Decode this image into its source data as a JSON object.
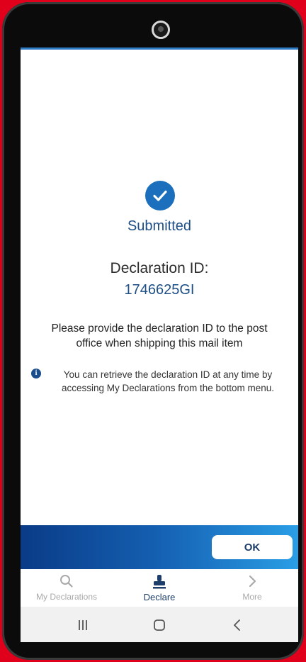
{
  "confirmation": {
    "status": "Submitted",
    "declaration_label": "Declaration ID:",
    "declaration_id": "1746625GI",
    "instruction": "Please provide the declaration ID to the post office when shipping this mail item",
    "info_icon": "info-icon",
    "info_text": "You can retrieve the declaration ID at any time by accessing My Declarations from the bottom menu."
  },
  "actions": {
    "ok_label": "OK"
  },
  "tabs": [
    {
      "label": "My Declarations",
      "icon": "search-icon",
      "active": false
    },
    {
      "label": "Declare",
      "icon": "stamp-icon",
      "active": true
    },
    {
      "label": "More",
      "icon": "chevron-right-icon",
      "active": false
    }
  ],
  "system_nav": {
    "recents_icon": "recents-icon",
    "home_icon": "home-icon",
    "back_icon": "back-icon"
  },
  "colors": {
    "accent": "#1b6fbd",
    "band_start": "#0a3b87",
    "band_end": "#2a9ee6",
    "frame": "#e0001b"
  }
}
